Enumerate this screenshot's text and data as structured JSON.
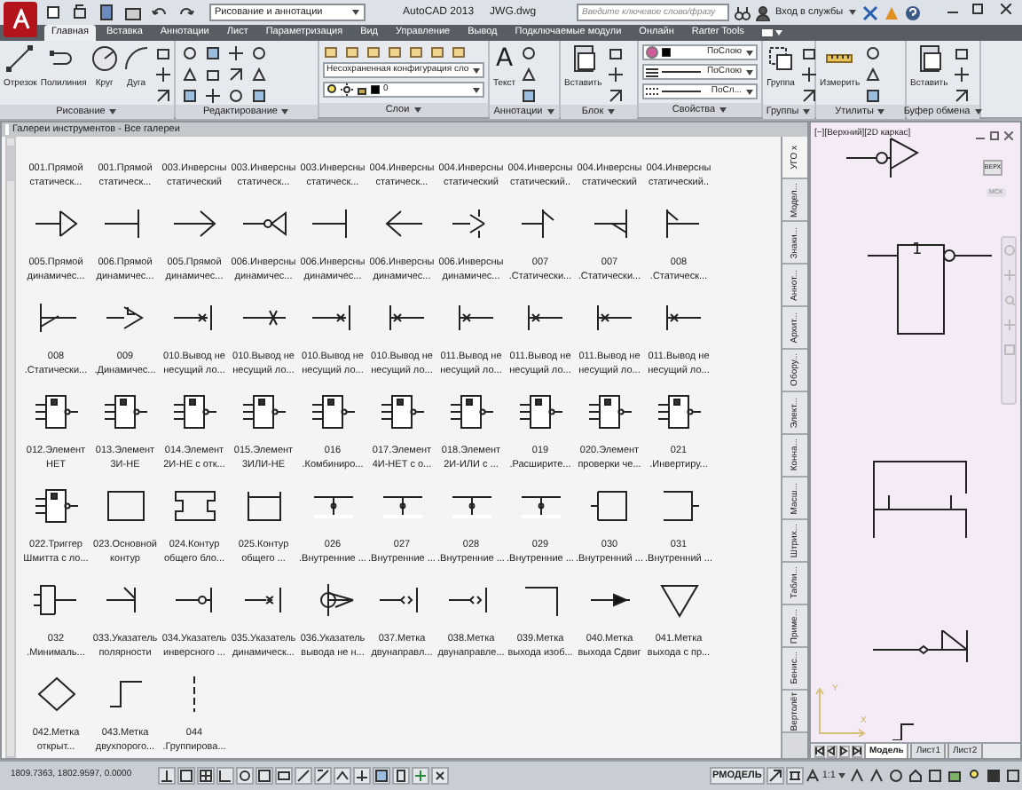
{
  "title_bar": {
    "workspace": "Рисование и аннотации",
    "app": "AutoCAD 2013",
    "file": "JWG.dwg",
    "search": {
      "placeholder": "Введите ключевое слово/фразу"
    },
    "sign_in": "Вход в службы"
  },
  "ribbon_tabs": [
    {
      "label": "Главная",
      "selected": true
    },
    {
      "label": "Вставка",
      "selected": false
    },
    {
      "label": "Аннотации",
      "selected": false
    },
    {
      "label": "Лист",
      "selected": false
    },
    {
      "label": "Параметризация",
      "selected": false
    },
    {
      "label": "Вид",
      "selected": false
    },
    {
      "label": "Управление",
      "selected": false
    },
    {
      "label": "Вывод",
      "selected": false
    },
    {
      "label": "Подключаемые модули",
      "selected": false
    },
    {
      "label": "Онлайн",
      "selected": false
    },
    {
      "label": "Rarter Tools",
      "selected": false
    }
  ],
  "ribbon_panels": [
    {
      "title": "Рисование",
      "buttons": [
        {
          "label": "Отрезок"
        },
        {
          "label": "Полилиния"
        },
        {
          "label": "Круг"
        },
        {
          "label": "Дуга"
        }
      ]
    },
    {
      "title": "Редактирование"
    },
    {
      "title": "Слои",
      "fields": [
        "Несохраненная конфигурация сло",
        "0"
      ]
    },
    {
      "title": "Аннотации",
      "buttons": [
        {
          "label": "Текст",
          "glyph": "A"
        }
      ]
    },
    {
      "title": "Блок",
      "buttons": [
        {
          "label": "Вставить"
        }
      ]
    },
    {
      "title": "Свойства",
      "fields": [
        "ПоСлою",
        "ПоСлою",
        "ПоСл..."
      ]
    },
    {
      "title": "Группы",
      "buttons": [
        {
          "label": "Группа"
        }
      ]
    },
    {
      "title": "Утилиты",
      "buttons": [
        {
          "label": "Измерить"
        }
      ]
    },
    {
      "title": "Буфер обмена",
      "buttons": [
        {
          "label": "Вставить"
        }
      ]
    }
  ],
  "palette": {
    "title": "Галереи инструментов - Все галереи",
    "rows": [
      {
        "cut_top": true,
        "items": [
          "001.Прямой статическ...",
          "001.Прямой статическ...",
          "003.Инверсны статический",
          "003.Инверсны статическ...",
          "003.Инверсны статическ...",
          "004.Инверсны статическ...",
          "004.Инверсны статический",
          "004.Инверсны статический..",
          "004.Инверсны статический",
          "004.Инверсны статический.."
        ]
      },
      {
        "cut_top": false,
        "items": [
          "005.Прямой динамичес...",
          "006.Прямой динамичес...",
          "005.Прямой динамичес...",
          "006.Инверсны динамичес...",
          "006.Инверсны динамичес...",
          "006.Инверсны динамичес...",
          "006.Инверсны динамичес...",
          "007 .Статически...",
          "007 .Статически...",
          "008 .Статическ..."
        ]
      },
      {
        "cut_top": false,
        "items": [
          "008 .Статически...",
          "009 .Динамичес...",
          "010.Вывод не несущий ло...",
          "010.Вывод не несущий ло...",
          "010.Вывод не несущий ло...",
          "010.Вывод не несущий ло...",
          "011.Вывод не несущий ло...",
          "011.Вывод не несущий ло...",
          "011.Вывод не несущий ло...",
          "011.Вывод не несущий ло..."
        ]
      },
      {
        "cut_top": false,
        "items": [
          "012.Элемент НЕТ",
          "013.Элемент 3И-НЕ",
          "014.Элемент 2И-НЕ с отк...",
          "015.Элемент 3ИЛИ-НЕ",
          "016 .Комбиниро...",
          "017.Элемент 4И-НЕТ с о...",
          "018.Элемент 2И-ИЛИ с ...",
          "019 .Расширите...",
          "020.Элемент проверки че...",
          "021 .Инвертиру..."
        ]
      },
      {
        "cut_top": false,
        "items": [
          "022.Триггер Шмитта с ло...",
          "023.Основной контур",
          "024.Контур общего бло...",
          "025.Контур общего ...",
          "026 .Внутренние ...",
          "027 .Внутренние ...",
          "028 .Внутренние ...",
          "029 .Внутренние ...",
          "030 .Внутренний ...",
          "031 .Внутренний ..."
        ]
      },
      {
        "cut_top": false,
        "items": [
          "032 .Минималь...",
          "033.Указатель полярности",
          "034.Указатель инверсного ...",
          "035.Указатель динамическ...",
          "036.Указатель вывода не н...",
          "037.Метка двунаправл...",
          "038.Метка двунаправле...",
          "039.Метка выхода изоб...",
          "040.Метка выхода Сдвиг",
          "041.Метка выхода с пр..."
        ]
      },
      {
        "cut_top": false,
        "items": [
          "042.Метка открыт...",
          "043.Метка двухпорого...",
          "044 .Группирова..."
        ]
      }
    ],
    "side_tabs": [
      {
        "label": "УГО х",
        "selected": true
      },
      {
        "label": "Модел...",
        "selected": false
      },
      {
        "label": "Знаки...",
        "selected": false
      },
      {
        "label": "Аннот...",
        "selected": false
      },
      {
        "label": "Архит...",
        "selected": false
      },
      {
        "label": "Обору...",
        "selected": false
      },
      {
        "label": "Элект...",
        "selected": false
      },
      {
        "label": "Конна...",
        "selected": false
      },
      {
        "label": "Масш...",
        "selected": false
      },
      {
        "label": "Штрих...",
        "selected": false
      },
      {
        "label": "Табли...",
        "selected": false
      },
      {
        "label": "Приме...",
        "selected": false
      },
      {
        "label": "Бенис...",
        "selected": false
      },
      {
        "label": "Вертолёт",
        "selected": false
      }
    ]
  },
  "viewport": {
    "header": "[−][Верхний][2D каркас]",
    "viewcube": "ВЕРХ",
    "ucs": "МСК",
    "gate_label": "1",
    "axis_x": "X",
    "axis_y": "Y",
    "layout_tabs": [
      {
        "label": "Модель",
        "selected": true
      },
      {
        "label": "Лист1",
        "selected": false
      },
      {
        "label": "Лист2",
        "selected": false
      }
    ]
  },
  "status_bar": {
    "coordinates": "1809.7363, 1802.9597, 0.0000",
    "space": "РМОДЕЛЬ",
    "scale": "1:1"
  }
}
